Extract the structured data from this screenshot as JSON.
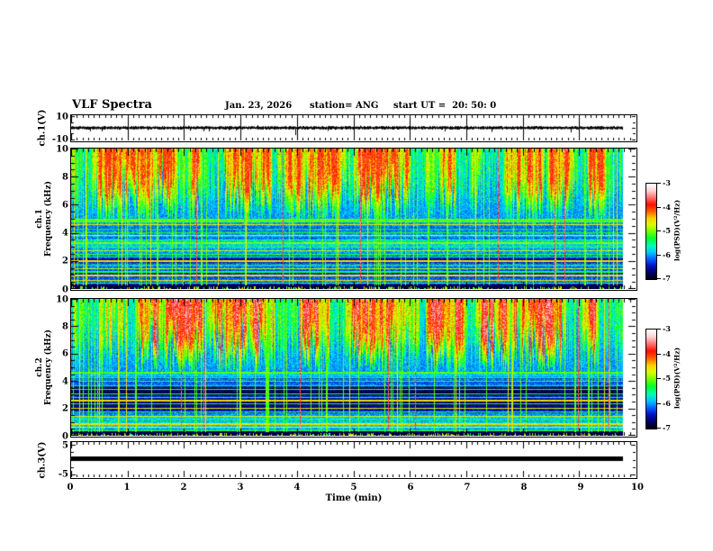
{
  "header": {
    "title": "VLF Spectra",
    "date": "Jan. 23, 2026",
    "station": "station= ANG",
    "start_ut": "start UT =  20: 50: 0"
  },
  "xaxis": {
    "label": "Time (min)",
    "ticks": [
      "0",
      "1",
      "2",
      "3",
      "4",
      "5",
      "6",
      "7",
      "8",
      "9",
      "10"
    ],
    "range_min": [
      0,
      10
    ]
  },
  "panels": {
    "ch1v": {
      "ylabel": "ch.1(V)",
      "yticks": [
        "10",
        "-10"
      ],
      "ylim": [
        -10,
        10
      ]
    },
    "spec1": {
      "ylabel_line1": "ch.1",
      "ylabel_line2": "Frequency (kHz)",
      "yticks": [
        "10",
        "8",
        "6",
        "4",
        "2",
        "0"
      ],
      "ylim": [
        0,
        10
      ]
    },
    "spec2": {
      "ylabel_line1": "ch.2",
      "ylabel_line2": "Frequency (kHz)",
      "yticks": [
        "10",
        "8",
        "6",
        "4",
        "2",
        "0"
      ],
      "ylim": [
        0,
        10
      ]
    },
    "ch3v": {
      "ylabel": "ch.3(V)",
      "yticks": [
        "5",
        "-5"
      ],
      "ylim": [
        -5,
        5
      ]
    }
  },
  "colorbar": {
    "label": "log(PSD)(V²/Hz)",
    "ticks": [
      "-3",
      "-4",
      "-5",
      "-6",
      "-7"
    ],
    "range": [
      -7,
      -3
    ],
    "colormap": [
      "#000008",
      "#000060",
      "#0010c0",
      "#0060ff",
      "#00c8ff",
      "#00ffb0",
      "#00ff30",
      "#70ff00",
      "#d8ff00",
      "#ffd000",
      "#ff6000",
      "#ff1000",
      "#ff7070",
      "#ffd0d0",
      "#ffffff"
    ]
  },
  "chart_data": [
    {
      "type": "line",
      "panel": "ch.1 voltage waveform",
      "ylabel": "ch.1(V)",
      "ylim": [
        -10,
        10
      ],
      "ytick_values": [
        10,
        -10
      ],
      "x_range_min": [
        0,
        9.78
      ],
      "baseline_v": 0,
      "noise_amplitude_v": 1.5,
      "spikes": [
        {
          "x_min": 0.55,
          "v": -3.0
        },
        {
          "x_min": 2.35,
          "v": -3.0
        },
        {
          "x_min": 3.97,
          "v": -6.3
        },
        {
          "x_min": 7.45,
          "v": -3.6
        },
        {
          "x_min": 8.85,
          "v": -4.0
        }
      ],
      "seed": 11
    },
    {
      "type": "heatmap",
      "panel": "ch.1 spectrogram",
      "ylabel": "ch.1 Frequency (kHz)",
      "ylim": [
        0,
        10
      ],
      "ytick_values": [
        0,
        2,
        4,
        6,
        8,
        10
      ],
      "zlabel": "log(PSD)(V²/Hz)",
      "zlim": [
        -7,
        -3
      ],
      "x_range_min": [
        0,
        9.78
      ],
      "sferics": {
        "base": 0.24,
        "gain": 0.8,
        "min_reach_khz": 4.62
      },
      "hum_band": {
        "f": 4.9,
        "w": 0.3,
        "v": 0.48
      },
      "h_lines": [
        {
          "f": 4.62,
          "w": 0.08,
          "v": 0.6
        },
        {
          "f": 4.32,
          "w": 0.07,
          "v": 0.42
        },
        {
          "f": 4.05,
          "w": 0.07,
          "v": 0.45
        },
        {
          "f": 3.82,
          "w": 0.07,
          "v": 0.55
        },
        {
          "f": 3.55,
          "w": 0.07,
          "v": 0.42
        },
        {
          "f": 3.3,
          "w": 0.07,
          "v": 0.5
        },
        {
          "f": 3.02,
          "w": 0.07,
          "v": 0.45
        },
        {
          "f": 2.78,
          "w": 0.07,
          "v": 0.55
        },
        {
          "f": 2.52,
          "w": 0.07,
          "v": 0.45
        },
        {
          "f": 2.3,
          "w": 0.07,
          "v": 0.42
        },
        {
          "f": 2.02,
          "w": 0.09,
          "v": 0.62
        },
        {
          "f": 1.72,
          "w": 0.07,
          "v": 0.45
        },
        {
          "f": 1.5,
          "w": 0.07,
          "v": 0.55
        },
        {
          "f": 1.25,
          "w": 0.07,
          "v": 0.42
        },
        {
          "f": 1.0,
          "w": 0.09,
          "v": 0.62
        },
        {
          "f": 0.8,
          "w": 0.06,
          "v": 0.5
        },
        {
          "f": 0.62,
          "w": 0.08,
          "v": 0.62
        },
        {
          "f": 0.45,
          "w": 0.06,
          "v": 0.45
        }
      ],
      "dark_band_khz": [
        0,
        0.38
      ],
      "n_vert_lines": 60,
      "n_strong_vert": 12,
      "n_red_vert": 6,
      "seed": 42
    },
    {
      "type": "heatmap",
      "panel": "ch.2 spectrogram",
      "ylabel": "ch.2 Frequency (kHz)",
      "ylim": [
        0,
        10
      ],
      "ytick_values": [
        0,
        2,
        4,
        6,
        8,
        10
      ],
      "zlabel": "log(PSD)(V²/Hz)",
      "zlim": [
        -7,
        -3
      ],
      "x_range_min": [
        0,
        9.78
      ],
      "sferics": {
        "base": 0.24,
        "gain": 0.95,
        "min_reach_khz": 4.55
      },
      "hum_band": {
        "f": 4.65,
        "w": 0.14,
        "v": 0.48
      },
      "h_lines": [
        {
          "f": 4.3,
          "w": 0.07,
          "v": 0.42
        },
        {
          "f": 4.0,
          "w": 0.07,
          "v": 0.45
        },
        {
          "f": 3.7,
          "w": 0.07,
          "v": 0.42
        },
        {
          "f": 3.4,
          "w": 0.07,
          "v": 0.48
        },
        {
          "f": 3.1,
          "w": 0.07,
          "v": 0.45
        },
        {
          "f": 2.85,
          "w": 0.07,
          "v": 0.42
        },
        {
          "f": 2.6,
          "w": 0.09,
          "v": 0.62
        },
        {
          "f": 2.35,
          "w": 0.07,
          "v": 0.45
        },
        {
          "f": 2.05,
          "w": 0.09,
          "v": 0.6
        },
        {
          "f": 1.75,
          "w": 0.07,
          "v": 0.45
        },
        {
          "f": 1.45,
          "w": 0.09,
          "v": 0.58
        },
        {
          "f": 1.2,
          "w": 0.07,
          "v": 0.42
        },
        {
          "f": 0.9,
          "w": 0.09,
          "v": 0.62
        },
        {
          "f": 0.65,
          "w": 0.08,
          "v": 0.6
        },
        {
          "f": 0.42,
          "w": 0.06,
          "v": 0.45
        }
      ],
      "dark_band_khz": [
        0,
        0.38
      ],
      "n_vert_lines": 60,
      "n_strong_vert": 12,
      "n_red_vert": 7,
      "seed": 77
    },
    {
      "type": "line",
      "panel": "ch.3 voltage waveform",
      "ylabel": "ch.3(V)",
      "ylim": [
        -5,
        5
      ],
      "ytick_values": [
        5,
        -5
      ],
      "x_range_min": [
        0,
        9.78
      ],
      "constant_v": 0.4,
      "line_thickness_px": 5,
      "seed": 5
    }
  ]
}
